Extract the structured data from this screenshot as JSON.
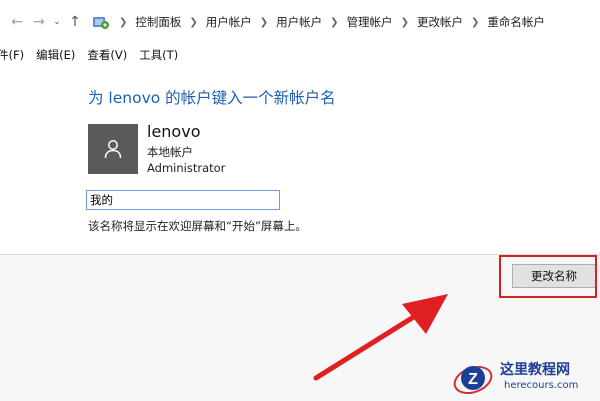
{
  "address_bar": {
    "back_icon": "arrow-left-icon",
    "forward_icon": "arrow-right-icon",
    "history_icon": "chevron-down-icon",
    "up_icon": "arrow-up-icon",
    "crumbs": [
      "控制面板",
      "用户帐户",
      "用户帐户",
      "管理帐户",
      "更改帐户",
      "重命名帐户"
    ]
  },
  "menu": {
    "items": [
      "件(F)",
      "编辑(E)",
      "查看(V)",
      "工具(T)"
    ]
  },
  "main": {
    "heading": "为 lenovo 的帐户键入一个新帐户名",
    "account": {
      "name": "lenovo",
      "type": "本地帐户",
      "role": "Administrator"
    },
    "name_input_value": "我的",
    "hint": "该名称将显示在欢迎屏幕和“开始”屏幕上。"
  },
  "footer": {
    "rename_button": "更改名称"
  },
  "annotation": {
    "highlight_color": "#d92020",
    "arrow_color": "#e02020"
  },
  "watermark": {
    "title": "这里教程网",
    "url": "herecours.com"
  },
  "colors": {
    "heading": "#1f5fb0",
    "avatar_bg": "#5a5a5a",
    "watermark": "#1e3f96"
  }
}
